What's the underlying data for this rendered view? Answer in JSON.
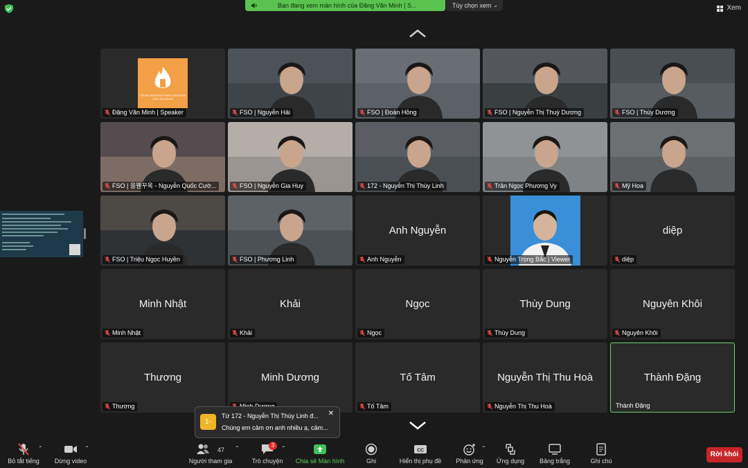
{
  "top_bar": {
    "banner_text": "Bạn đang xem màn hình của Đặng Văn Minh | S...",
    "view_options_label": "Tùy chọn xem",
    "view_button_label": "Xem"
  },
  "tiles": [
    {
      "label": "Đặng Văn Minh | Speaker",
      "kind": "logo",
      "logo_text": "TRUNG NGUYEN PHAN LUYEN DAI HOC CHUAN BI",
      "muted": true
    },
    {
      "label": "FSO | Nguyễn Hải",
      "kind": "video",
      "muted": true
    },
    {
      "label": "FSO | Đoàn Hồng",
      "kind": "video",
      "muted": true
    },
    {
      "label": "FSO | Nguyễn Thị Thuỳ Dương",
      "kind": "video",
      "muted": true
    },
    {
      "label": "FSO | Thùy Dương",
      "kind": "video",
      "muted": true
    },
    {
      "label": "FSO | 응웬꾸옥 - Nguyễn Quốc Cườ...",
      "kind": "video",
      "muted": true
    },
    {
      "label": "FSO | Nguyễn Gia Huy",
      "kind": "video",
      "muted": true
    },
    {
      "label": "172 - Nguyễn Thị Thùy Linh",
      "kind": "video",
      "muted": true
    },
    {
      "label": "Trần Ngọc Phương Vy",
      "kind": "video",
      "muted": true
    },
    {
      "label": "Mỹ Hoa",
      "kind": "video",
      "muted": true
    },
    {
      "label": "FSO | Triệu Ngọc Huyền",
      "kind": "video",
      "muted": true
    },
    {
      "label": "FSO | Phương Linh",
      "kind": "video",
      "muted": true
    },
    {
      "label": "Anh Nguyễn",
      "kind": "name",
      "center_name": "Anh Nguyễn",
      "muted": true
    },
    {
      "label": "Nguyễn Trọng Bắc | Viewer",
      "kind": "photo",
      "muted": true
    },
    {
      "label": "diệp",
      "kind": "name",
      "center_name": "diệp",
      "muted": true
    },
    {
      "label": "Minh Nhật",
      "kind": "name",
      "center_name": "Minh Nhật",
      "muted": true
    },
    {
      "label": "Khải",
      "kind": "name",
      "center_name": "Khải",
      "muted": true
    },
    {
      "label": "Ngọc",
      "kind": "name",
      "center_name": "Ngọc",
      "muted": true
    },
    {
      "label": "Thùy Dung",
      "kind": "name",
      "center_name": "Thùy Dung",
      "muted": true
    },
    {
      "label": "Nguyên Khôi",
      "kind": "name",
      "center_name": "Nguyên Khôi",
      "muted": true
    },
    {
      "label": "Thương",
      "kind": "name",
      "center_name": "Thương",
      "muted": true
    },
    {
      "label": "Minh Dương",
      "kind": "name",
      "center_name": "Minh Dương",
      "muted": true
    },
    {
      "label": "Tố Tâm",
      "kind": "name",
      "center_name": "Tố Tâm",
      "muted": true
    },
    {
      "label": "Nguyễn Thị Thu Hoà",
      "kind": "name",
      "center_name": "Nguyễn Thị Thu Hoà",
      "muted": true
    },
    {
      "label": "Thành Đặng",
      "kind": "name",
      "center_name": "Thành Đặng",
      "muted": false,
      "active": true
    }
  ],
  "toast": {
    "badge": "1-",
    "line1": "Từ 172 - Nguyễn Thị Thùy Linh đ...",
    "line2": "Chúng em cảm ơn anh nhiều ạ, cảm..."
  },
  "toolbar": {
    "mute_all": "Bỏ tắt tiếng",
    "stop_video": "Dừng video",
    "participants": "Người tham gia",
    "participants_count": "47",
    "chat": "Trò chuyện",
    "chat_badge": "3",
    "share_screen": "Chia sẻ Màn hình",
    "record": "Ghi",
    "captions": "Hiển thị phụ đề",
    "captions_icon_text": "CC",
    "reactions": "Phản ứng",
    "apps": "Ứng dụng",
    "whiteboard": "Bảng trắng",
    "notes": "Ghi chú",
    "leave": "Rời khỏi"
  },
  "colors": {
    "share_green": "#5ac34f",
    "leave_red": "#c6252a",
    "muted_red": "#e24a4a",
    "active_border": "#6fd26f"
  }
}
